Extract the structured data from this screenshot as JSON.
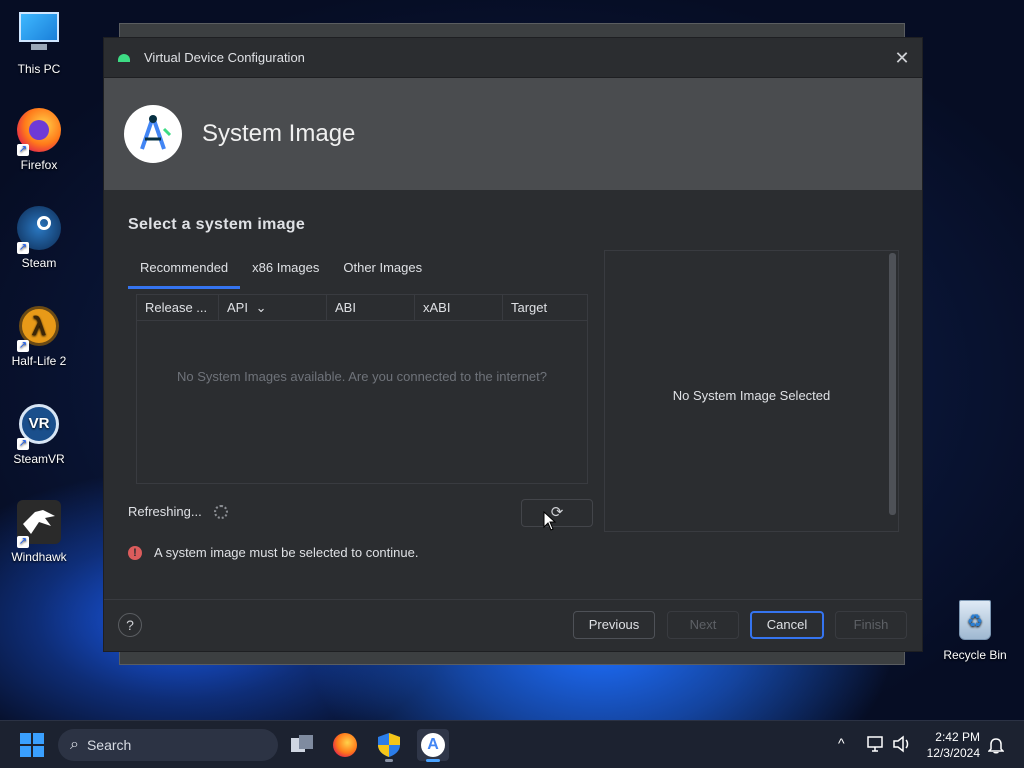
{
  "desktop": {
    "icons": [
      {
        "label": "This PC"
      },
      {
        "label": "Firefox"
      },
      {
        "label": "Steam"
      },
      {
        "label": "Half-Life 2"
      },
      {
        "label": "SteamVR"
      },
      {
        "label": "Windhawk"
      },
      {
        "label": "Recycle Bin"
      }
    ]
  },
  "dialog": {
    "window_title": "Virtual Device Configuration",
    "close_glyph": "✕",
    "header_title": "System Image",
    "subtitle": "Select a system image",
    "tabs": [
      {
        "label": "Recommended",
        "active": true
      },
      {
        "label": "x86 Images",
        "active": false
      },
      {
        "label": "Other Images",
        "active": false
      }
    ],
    "table": {
      "columns": [
        "Release ...",
        "API",
        "ABI",
        "xABI",
        "Target"
      ],
      "sort_glyph": "⌄",
      "empty_text": "No System Images available. Are you connected to the internet?"
    },
    "refreshing_text": "Refreshing...",
    "refresh_glyph": "⟳",
    "error_icon": "!",
    "error_text": "A system image must be selected to continue.",
    "details_text": "No System Image Selected",
    "help_glyph": "?",
    "buttons": {
      "previous": "Previous",
      "next": "Next",
      "cancel": "Cancel",
      "finish": "Finish"
    }
  },
  "taskbar": {
    "search_label": "Search",
    "time": "2:42 PM",
    "date": "12/3/2024",
    "chevron": "^",
    "bell": "🔔"
  },
  "colors": {
    "accent": "#3574f0",
    "error": "#db5c5c",
    "android_green": "#3ddc84"
  }
}
